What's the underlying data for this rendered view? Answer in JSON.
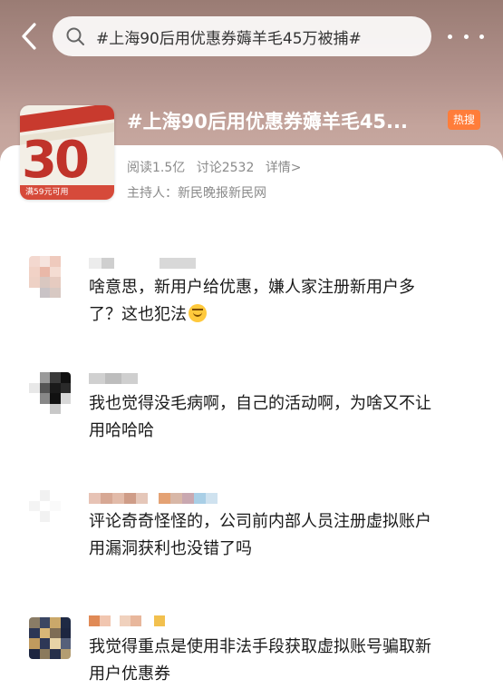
{
  "header": {
    "search_value": "#上海90后用优惠券薅羊毛45万被捕#"
  },
  "topic": {
    "title": "#上海90后用优惠券薅羊毛45...",
    "badge": "热搜",
    "reads": "阅读1.5亿",
    "discussions": "讨论2532",
    "details": "详情>",
    "host": "主持人：新民晚报新民网",
    "thumbnail_text": "30",
    "thumbnail_footer": "满59元可用"
  },
  "comments": [
    {
      "text_line1": "啥意思，新用户给优惠，嫌人家注册新用户多",
      "text_line2": "了？这也犯法"
    },
    {
      "text_line1": "我也觉得没毛病啊，自己的活动啊，为啥又不让",
      "text_line2": "用哈哈哈"
    },
    {
      "text_line1": "评论奇奇怪怪的，公司前内部人员注册虚拟账户",
      "text_line2": "用漏洞获利也没错了吗"
    },
    {
      "text_line1": "我觉得重点是使用非法手段获取虚拟账号骗取新",
      "text_line2": "用户优惠券"
    }
  ],
  "icons": {
    "back": "chevron-left-icon",
    "search": "search-icon",
    "more": "more-dots-icon",
    "emoji": "sad-face-emoji"
  },
  "colors": {
    "header_gradient_top": "#9a7c74",
    "hot_badge": "#ff7d3a",
    "meta_text": "#8a8a8a"
  }
}
